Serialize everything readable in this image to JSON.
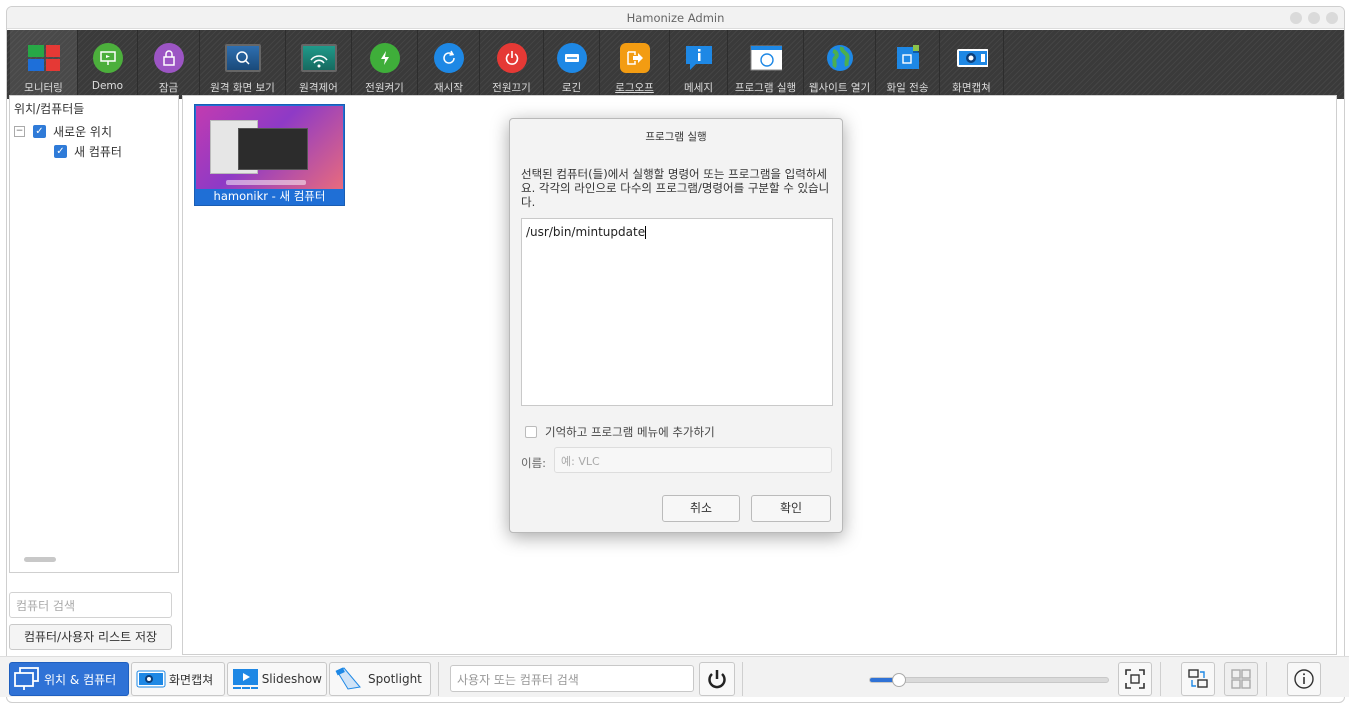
{
  "window": {
    "title": "Hamonize Admin"
  },
  "toolbar": {
    "items": [
      {
        "label": "모니터링"
      },
      {
        "label": "Demo"
      },
      {
        "label": "잠금"
      },
      {
        "label": "원격 화면 보기"
      },
      {
        "label": "원격제어"
      },
      {
        "label": "전원켜기"
      },
      {
        "label": "재시작"
      },
      {
        "label": "전원끄기"
      },
      {
        "label": "로긴"
      },
      {
        "label": "로그오프"
      },
      {
        "label": "메세지"
      },
      {
        "label": "프로그램 실행"
      },
      {
        "label": "웹사이트 열기"
      },
      {
        "label": "화일 전송"
      },
      {
        "label": "화면캡쳐"
      }
    ]
  },
  "sidebar": {
    "header": "위치/컴퓨터들",
    "location": "새로운 위치",
    "computer": "새 컴퓨터",
    "search_placeholder": "컴퓨터 검색",
    "save_label": "컴퓨터/사용자 리스트 저장"
  },
  "main": {
    "thumbnail_caption": "hamonikr - 새 컴퓨터"
  },
  "dialog": {
    "title": "프로그램 실행",
    "prompt": "선택된 컴퓨터(들)에서 실행할 명령어 또는 프로그램을 입력하세요. 각각의 라인으로 다수의 프로그램/명령어를 구분할 수 있습니다.",
    "command": "/usr/bin/mintupdate",
    "remember_label": "기억하고 프로그램 메뉴에 추가하기",
    "name_label": "이름:",
    "name_placeholder": "예: VLC",
    "cancel_label": "취소",
    "ok_label": "확인"
  },
  "bottombar": {
    "tab_locations": "위치 & 컴퓨터",
    "tab_screenshots": "화면캡쳐",
    "tab_slideshow": "Slideshow",
    "tab_spotlight": "Spotlight",
    "search_placeholder": "사용자 또는 컴퓨터 검색",
    "zoom_level": 0.12
  },
  "colors": {
    "accent": "#2f72d6",
    "toolbar": "#3a3a3a"
  }
}
